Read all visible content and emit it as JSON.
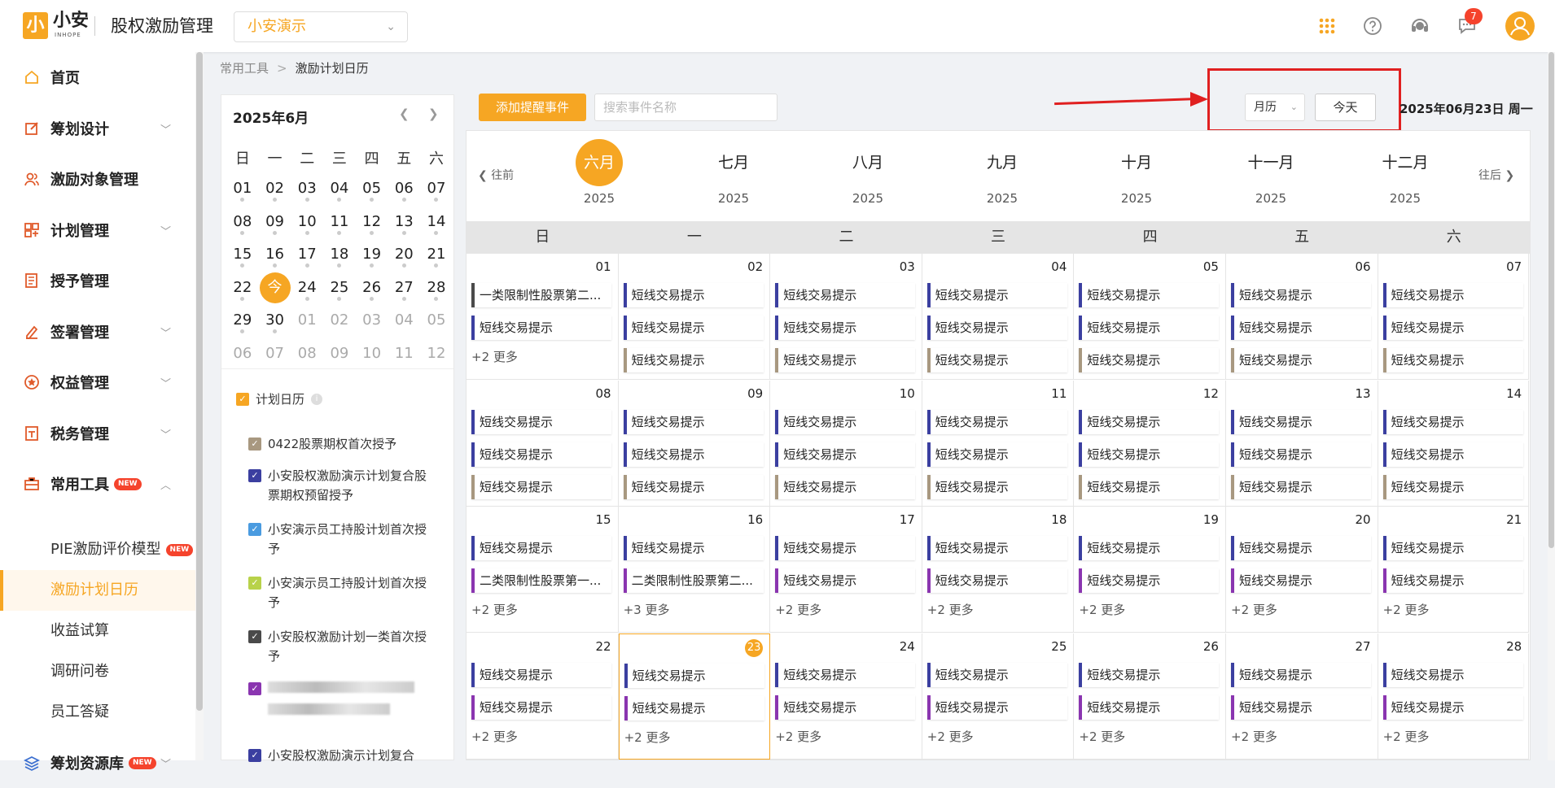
{
  "topbar": {
    "logo_mark": "小",
    "logo_name": "小安",
    "logo_sub": "INHOPE",
    "app_title": "股权激励管理",
    "company": "小安演示",
    "notif_count": "7"
  },
  "sidebar": {
    "items": [
      {
        "name": "home",
        "label": "首页",
        "icon": "home-icon",
        "has_arrow": false
      },
      {
        "name": "planning-design",
        "label": "筹划设计",
        "icon": "edit-icon",
        "has_arrow": true
      },
      {
        "name": "target-management",
        "label": "激励对象管理",
        "icon": "users-icon",
        "has_arrow": false
      },
      {
        "name": "plan-management",
        "label": "计划管理",
        "icon": "grid-icon",
        "has_arrow": true
      },
      {
        "name": "grant-management",
        "label": "授予管理",
        "icon": "document-icon",
        "has_arrow": false
      },
      {
        "name": "signing-management",
        "label": "签署管理",
        "icon": "pen-icon",
        "has_arrow": true
      },
      {
        "name": "equity-management",
        "label": "权益管理",
        "icon": "equity-icon",
        "has_arrow": true
      },
      {
        "name": "tax-management",
        "label": "税务管理",
        "icon": "tax-icon",
        "has_arrow": true
      },
      {
        "name": "common-tools",
        "label": "常用工具",
        "icon": "toolbox-icon",
        "has_arrow": true,
        "new": true
      }
    ],
    "sub_items": [
      {
        "label": "PIE激励评价模型",
        "new": true,
        "active": false
      },
      {
        "label": "激励计划日历",
        "new": false,
        "active": true
      },
      {
        "label": "收益试算",
        "new": false,
        "active": false
      },
      {
        "label": "调研问卷",
        "new": false,
        "active": false
      },
      {
        "label": "员工答疑",
        "new": false,
        "active": false
      }
    ],
    "bottom_item": {
      "label": "筹划资源库",
      "icon": "layers-icon",
      "new": true
    },
    "new_label": "NEW"
  },
  "breadcrumb": {
    "parent": "常用工具",
    "current": "激励计划日历"
  },
  "mini_calendar": {
    "title": "2025年6月",
    "weekdays": [
      "日",
      "一",
      "二",
      "三",
      "四",
      "五",
      "六"
    ],
    "rows": [
      [
        "01",
        "02",
        "03",
        "04",
        "05",
        "06",
        "07"
      ],
      [
        "08",
        "09",
        "10",
        "11",
        "12",
        "13",
        "14"
      ],
      [
        "15",
        "16",
        "17",
        "18",
        "19",
        "20",
        "21"
      ],
      [
        "22",
        "今",
        "24",
        "25",
        "26",
        "27",
        "28"
      ],
      [
        "29",
        "30",
        "01",
        "02",
        "03",
        "04",
        "05"
      ],
      [
        "06",
        "07",
        "08",
        "09",
        "10",
        "11",
        "12"
      ]
    ],
    "today_label": "今"
  },
  "plan_calendar": {
    "label": "计划日历",
    "plans": [
      {
        "label": "0422股票期权首次授予",
        "color": "#a89880"
      },
      {
        "label": "小安股权激励演示计划复合股票期权预留授予",
        "color": "#3b3fa0"
      },
      {
        "label": "小安演示员工持股计划首次授予",
        "color": "#4a9be0"
      },
      {
        "label": "小安演示员工持股计划首次授予",
        "color": "#b8d24a"
      },
      {
        "label": "小安股权激励计划一类首次授予",
        "color": "#4a4a4a"
      },
      {
        "label": "",
        "color": "#8a35b0"
      },
      {
        "label": "小安股权激励演示计划复合",
        "color": "#3b3fa0"
      }
    ]
  },
  "toolbar": {
    "add_label": "添加提醒事件",
    "search_placeholder": "搜索事件名称",
    "view_label": "月历",
    "today_label": "今天",
    "current_date": "2025年06月23日 周一"
  },
  "month_strip": {
    "prev_label": "往前",
    "next_label": "往后",
    "months": [
      {
        "name": "六月",
        "year": "2025",
        "active": true
      },
      {
        "name": "七月",
        "year": "2025",
        "active": false
      },
      {
        "name": "八月",
        "year": "2025",
        "active": false
      },
      {
        "name": "九月",
        "year": "2025",
        "active": false
      },
      {
        "name": "十月",
        "year": "2025",
        "active": false
      },
      {
        "name": "十一月",
        "year": "2025",
        "active": false
      },
      {
        "name": "十二月",
        "year": "2025",
        "active": false
      }
    ]
  },
  "grid": {
    "weekdays": [
      "日",
      "一",
      "二",
      "三",
      "四",
      "五",
      "六"
    ],
    "colors": {
      "blue": "#3b3fa0",
      "tan": "#a89880",
      "gray": "#4a4a4a",
      "purple": "#8a35b0"
    },
    "weeks": [
      [
        {
          "day": "01",
          "events": [
            [
              "一类限制性股票第二...",
              "gray"
            ],
            [
              "短线交易提示",
              "blue"
            ]
          ],
          "more": "+2 更多"
        },
        {
          "day": "02",
          "events": [
            [
              "短线交易提示",
              "blue"
            ],
            [
              "短线交易提示",
              "blue"
            ],
            [
              "短线交易提示",
              "tan"
            ]
          ]
        },
        {
          "day": "03",
          "events": [
            [
              "短线交易提示",
              "blue"
            ],
            [
              "短线交易提示",
              "blue"
            ],
            [
              "短线交易提示",
              "tan"
            ]
          ]
        },
        {
          "day": "04",
          "events": [
            [
              "短线交易提示",
              "blue"
            ],
            [
              "短线交易提示",
              "blue"
            ],
            [
              "短线交易提示",
              "tan"
            ]
          ]
        },
        {
          "day": "05",
          "events": [
            [
              "短线交易提示",
              "blue"
            ],
            [
              "短线交易提示",
              "blue"
            ],
            [
              "短线交易提示",
              "tan"
            ]
          ]
        },
        {
          "day": "06",
          "events": [
            [
              "短线交易提示",
              "blue"
            ],
            [
              "短线交易提示",
              "blue"
            ],
            [
              "短线交易提示",
              "tan"
            ]
          ]
        },
        {
          "day": "07",
          "events": [
            [
              "短线交易提示",
              "blue"
            ],
            [
              "短线交易提示",
              "blue"
            ],
            [
              "短线交易提示",
              "tan"
            ]
          ]
        }
      ],
      [
        {
          "day": "08",
          "events": [
            [
              "短线交易提示",
              "blue"
            ],
            [
              "短线交易提示",
              "blue"
            ],
            [
              "短线交易提示",
              "tan"
            ]
          ]
        },
        {
          "day": "09",
          "events": [
            [
              "短线交易提示",
              "blue"
            ],
            [
              "短线交易提示",
              "blue"
            ],
            [
              "短线交易提示",
              "tan"
            ]
          ]
        },
        {
          "day": "10",
          "events": [
            [
              "短线交易提示",
              "blue"
            ],
            [
              "短线交易提示",
              "blue"
            ],
            [
              "短线交易提示",
              "tan"
            ]
          ]
        },
        {
          "day": "11",
          "events": [
            [
              "短线交易提示",
              "blue"
            ],
            [
              "短线交易提示",
              "blue"
            ],
            [
              "短线交易提示",
              "tan"
            ]
          ]
        },
        {
          "day": "12",
          "events": [
            [
              "短线交易提示",
              "blue"
            ],
            [
              "短线交易提示",
              "blue"
            ],
            [
              "短线交易提示",
              "tan"
            ]
          ]
        },
        {
          "day": "13",
          "events": [
            [
              "短线交易提示",
              "blue"
            ],
            [
              "短线交易提示",
              "blue"
            ],
            [
              "短线交易提示",
              "tan"
            ]
          ]
        },
        {
          "day": "14",
          "events": [
            [
              "短线交易提示",
              "blue"
            ],
            [
              "短线交易提示",
              "blue"
            ],
            [
              "短线交易提示",
              "tan"
            ]
          ]
        }
      ],
      [
        {
          "day": "15",
          "events": [
            [
              "短线交易提示",
              "blue"
            ],
            [
              "二类限制性股票第一...",
              "purple"
            ]
          ],
          "more": "+2 更多"
        },
        {
          "day": "16",
          "events": [
            [
              "短线交易提示",
              "blue"
            ],
            [
              "二类限制性股票第二...",
              "purple"
            ]
          ],
          "more": "+3 更多"
        },
        {
          "day": "17",
          "events": [
            [
              "短线交易提示",
              "blue"
            ],
            [
              "短线交易提示",
              "purple"
            ]
          ],
          "more": "+2 更多"
        },
        {
          "day": "18",
          "events": [
            [
              "短线交易提示",
              "blue"
            ],
            [
              "短线交易提示",
              "purple"
            ]
          ],
          "more": "+2 更多"
        },
        {
          "day": "19",
          "events": [
            [
              "短线交易提示",
              "blue"
            ],
            [
              "短线交易提示",
              "purple"
            ]
          ],
          "more": "+2 更多"
        },
        {
          "day": "20",
          "events": [
            [
              "短线交易提示",
              "blue"
            ],
            [
              "短线交易提示",
              "purple"
            ]
          ],
          "more": "+2 更多"
        },
        {
          "day": "21",
          "events": [
            [
              "短线交易提示",
              "blue"
            ],
            [
              "短线交易提示",
              "purple"
            ]
          ],
          "more": "+2 更多"
        }
      ],
      [
        {
          "day": "22",
          "events": [
            [
              "短线交易提示",
              "blue"
            ],
            [
              "短线交易提示",
              "purple"
            ]
          ],
          "more": "+2 更多"
        },
        {
          "day": "23",
          "today": true,
          "events": [
            [
              "短线交易提示",
              "blue"
            ],
            [
              "短线交易提示",
              "purple"
            ]
          ],
          "more": "+2 更多"
        },
        {
          "day": "24",
          "events": [
            [
              "短线交易提示",
              "blue"
            ],
            [
              "短线交易提示",
              "purple"
            ]
          ],
          "more": "+2 更多"
        },
        {
          "day": "25",
          "events": [
            [
              "短线交易提示",
              "blue"
            ],
            [
              "短线交易提示",
              "purple"
            ]
          ],
          "more": "+2 更多"
        },
        {
          "day": "26",
          "events": [
            [
              "短线交易提示",
              "blue"
            ],
            [
              "短线交易提示",
              "purple"
            ]
          ],
          "more": "+2 更多"
        },
        {
          "day": "27",
          "events": [
            [
              "短线交易提示",
              "blue"
            ],
            [
              "短线交易提示",
              "purple"
            ]
          ],
          "more": "+2 更多"
        },
        {
          "day": "28",
          "events": [
            [
              "短线交易提示",
              "blue"
            ],
            [
              "短线交易提示",
              "purple"
            ]
          ],
          "more": "+2 更多"
        }
      ]
    ]
  }
}
